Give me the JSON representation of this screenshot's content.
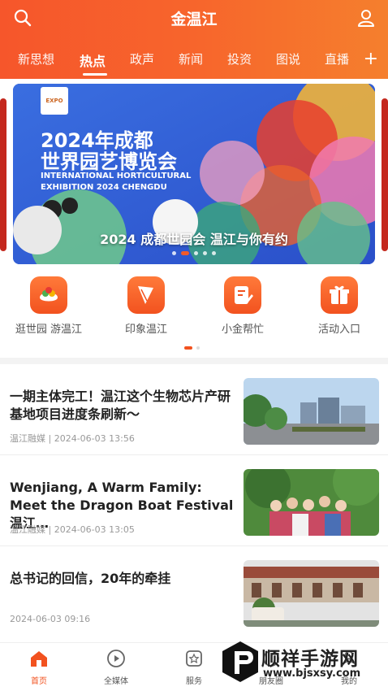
{
  "header": {
    "title": "金温江",
    "tabs": [
      "新思想",
      "热点",
      "政声",
      "新闻",
      "投资",
      "图说",
      "直播"
    ],
    "active_tab": "热点",
    "add_symbol": "+",
    "icons": [
      "search-icon",
      "user-icon",
      "add-tab-icon"
    ]
  },
  "banner": {
    "logo_text": "EXPO",
    "title_line1": "2024年成都",
    "title_line2": "世界园艺博览会",
    "en_line1": "INTERNATIONAL HORTICULTURAL",
    "en_line2": "EXHIBITION 2024 CHENGDU",
    "caption": "2024 成都世园会 温江与你有约",
    "slide_count": 5,
    "active_slide": 2
  },
  "quick_links": [
    {
      "label": "逛世园 游温江",
      "icon": "expo-icon"
    },
    {
      "label": "印象温江",
      "icon": "landmark-icon"
    },
    {
      "label": "小金帮忙",
      "icon": "edit-icon"
    },
    {
      "label": "活动入口",
      "icon": "gift-icon"
    }
  ],
  "news": [
    {
      "title": "一期主体完工！温江这个生物芯片产研基地项目进度条刷新～",
      "meta": "温江融媒 | 2024-06-03 13:56"
    },
    {
      "title": "Wenjiang, A Warm Family: Meet the Dragon Boat Festival 温江…",
      "meta": "温江融媒 | 2024-06-03 13:05"
    },
    {
      "title": "总书记的回信，20年的牵挂",
      "meta": "2024-06-03 09:16"
    }
  ],
  "bottom_nav": [
    {
      "label": "首页",
      "icon": "home-icon",
      "active": true
    },
    {
      "label": "全媒体",
      "icon": "play-icon",
      "active": false
    },
    {
      "label": "服务",
      "icon": "star-icon",
      "active": false
    },
    {
      "label": "朋友圈",
      "icon": "circle-icon",
      "active": false
    },
    {
      "label": "我的",
      "icon": "profile-icon",
      "active": false
    }
  ],
  "watermark": {
    "title": "顺祥手游网",
    "url": "www.bjsxsy.com"
  },
  "colors": {
    "accent": "#f2521f",
    "header_start": "#f6562b",
    "header_end": "#f57f2d"
  }
}
